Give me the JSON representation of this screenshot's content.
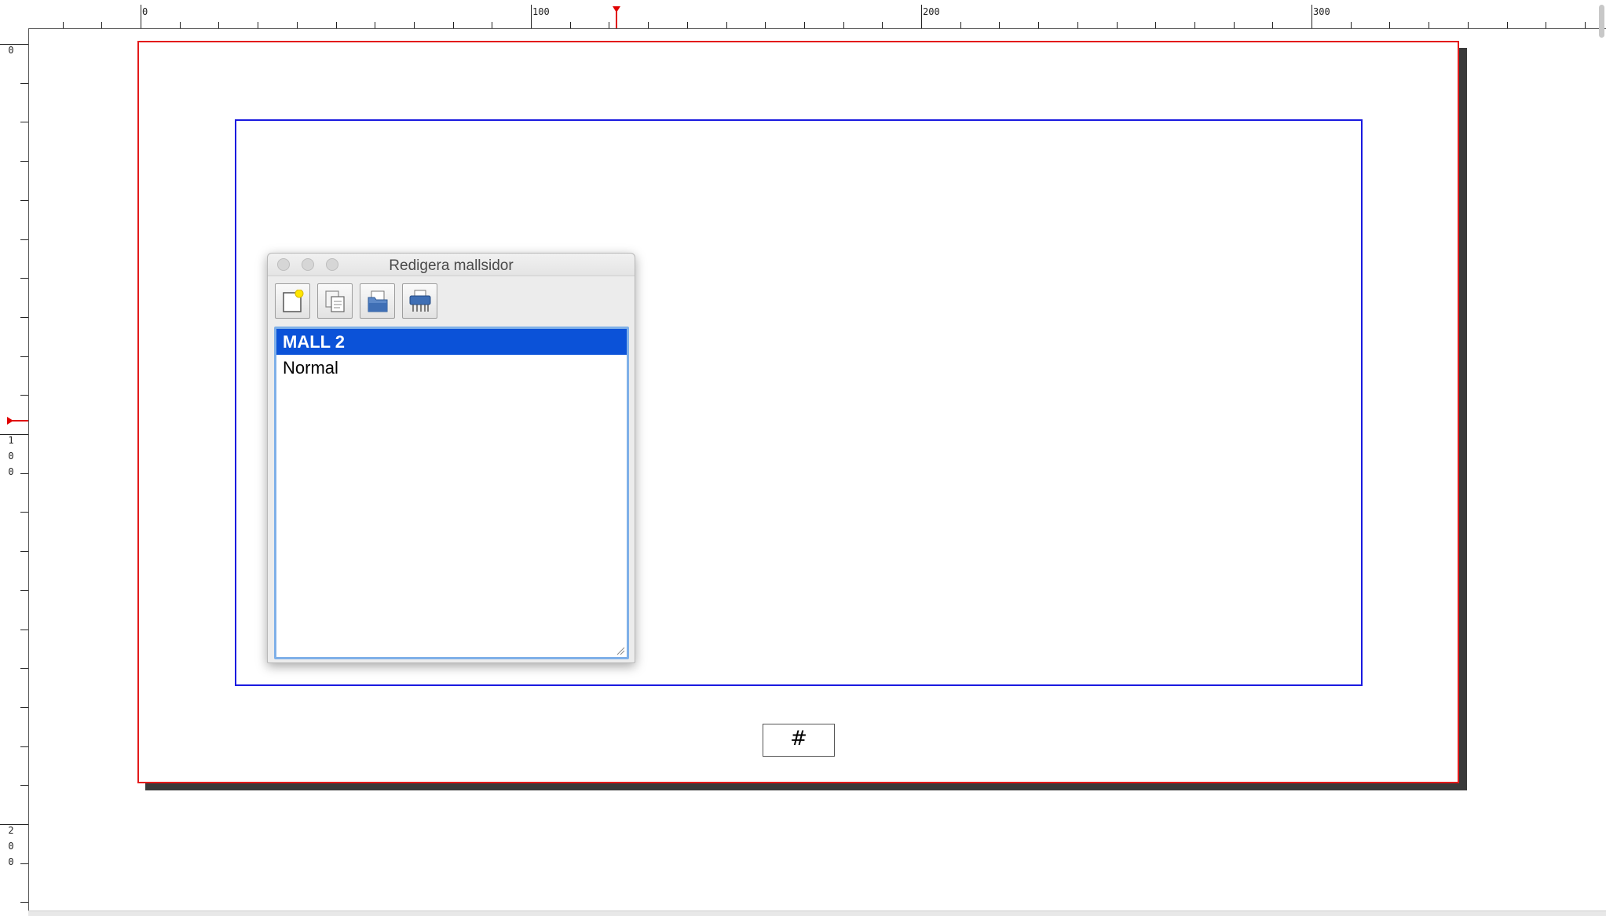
{
  "rulers": {
    "horizontal_labels": [
      "0",
      "100",
      "200",
      "300"
    ],
    "vertical_labels": [
      [
        "0"
      ],
      [
        "1",
        "0",
        "0"
      ],
      [
        "2",
        "0",
        "0"
      ]
    ]
  },
  "page": {
    "page_number_placeholder": "#"
  },
  "palette": {
    "title": "Redigera mallsidor",
    "tools": [
      {
        "name": "new-master-page",
        "icon": "new-page-icon"
      },
      {
        "name": "duplicate-master-page",
        "icon": "duplicate-icon"
      },
      {
        "name": "import-master-page",
        "icon": "import-icon"
      },
      {
        "name": "delete-master-page",
        "icon": "shredder-icon"
      }
    ],
    "items": [
      {
        "label": "MALL 2",
        "selected": true
      },
      {
        "label": "Normal",
        "selected": false
      }
    ]
  },
  "colors": {
    "page_border": "#e31a1a",
    "margin_guide": "#1a1ae0",
    "selection": "#0b52d8",
    "ruler_marker": "#e00000"
  }
}
